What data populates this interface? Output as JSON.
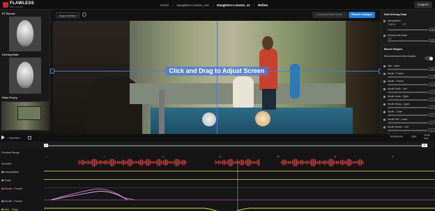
{
  "topbar": {
    "logo_title": "FLAWLESS",
    "logo_subtitle": "HOLLYWOOD",
    "breadcrumbs": [
      "Home",
      "Daughters Lesson_tee",
      "Daughters Lesson_v1",
      "Refine"
    ],
    "support_label": "Support"
  },
  "left_panel": {
    "pt_result_label": "PT Result",
    "driving_data_label": "Driving Data",
    "plate_proxy_label": "Plate Proxy"
  },
  "toolbar": {
    "output_media_label": "Output Media",
    "download_label": "Download latest render",
    "render_label": "Render changes"
  },
  "viewer": {
    "overlay_text": "Click and Drag to Adjust Screen"
  },
  "right_panel": {
    "edit_driving_header": "Edit Driving Data",
    "interpolation_label": "Interpolation",
    "interpolation_sub": "Original",
    "interpolation_value": "100",
    "interpolation_end": "100",
    "driving_scale_label": "Driving Data Scale",
    "driving_scale_value": "100",
    "driving_scale_end": "100",
    "blend_header": "Blend Shapes",
    "show_advanced_label": "Show advanced blend shapes",
    "blendshapes": [
      {
        "label": "Jaw - Open",
        "value": "-50"
      },
      {
        "label": "Mouth - Pucker",
        "value": "0"
      },
      {
        "label": "Mouth - Funnel",
        "value": "0"
      },
      {
        "label": "Mouth Smile - Left",
        "value": "0"
      },
      {
        "label": "Mouth Smile - Right",
        "value": "0"
      },
      {
        "label": "Mouth Shrug - Upper",
        "value": "0"
      },
      {
        "label": "Mouth - Close",
        "value": "0"
      },
      {
        "label": "Mouth Roll - Lower",
        "value": "0"
      },
      {
        "label": "Mouth Stretch - Left",
        "value": "0"
      },
      {
        "label": "Mouth Stretch - Right",
        "value": "0"
      }
    ]
  },
  "transport": {
    "mode_label": "Normal",
    "timecode": "00:00:00:00",
    "frame": "0021",
    "fps": "23.98",
    "fps_unit": "FPS"
  },
  "scrubber": {
    "start": "1",
    "end": "41"
  },
  "timeline": {
    "preview_range_label": "Preview Range",
    "ticks": [
      "1",
      "7",
      "13",
      "19",
      "25",
      "31",
      "37"
    ],
    "tracks": [
      {
        "label": "Audio",
        "color": "#e05050"
      },
      {
        "label": "Interpolation",
        "color": "#e8d84a"
      },
      {
        "label": "Scale",
        "color": "#e8d84a"
      },
      {
        "label": "Mouth - Funnel",
        "color": "#e86bd0"
      },
      {
        "label": "Mouth - Pucker",
        "color": "#d4b8ff"
      },
      {
        "label": "Jaw - Open",
        "color": "#e8d84a"
      }
    ]
  },
  "colors": {
    "accent": "#1e7fd6",
    "brand_red": "#d4232b",
    "audio_wave": "#c83c3c"
  }
}
